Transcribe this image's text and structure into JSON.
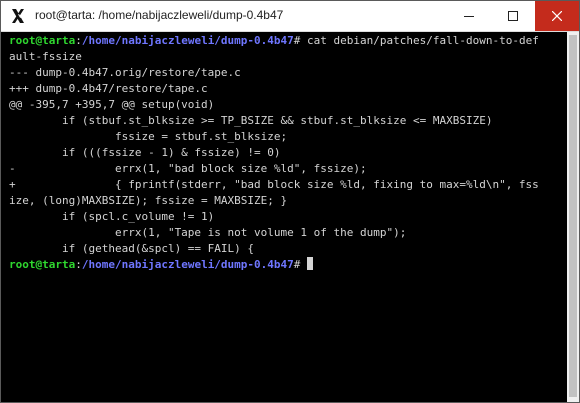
{
  "window": {
    "title": "root@tarta: /home/nabijaczleweli/dump-0.4b47",
    "app_icon": "x-window-icon",
    "controls": [
      "minimize-icon",
      "maximize-icon",
      "close-icon"
    ],
    "close_color": "#c42b1c"
  },
  "terminal": {
    "prompt": {
      "user_host": "root@tarta",
      "colon": ":",
      "path": "/home/nabijaczleweli/dump-0.4b47",
      "symbol": "#"
    },
    "command": " cat debian/patches/fall-down-to-def",
    "command_wrap": "ault-fssize",
    "output": [
      "--- dump-0.4b47.orig/restore/tape.c",
      "+++ dump-0.4b47/restore/tape.c",
      "@@ -395,7 +395,7 @@ setup(void)",
      "        if (stbuf.st_blksize >= TP_BSIZE && stbuf.st_blksize <= MAXBSIZE)",
      "                fssize = stbuf.st_blksize;",
      "        if (((fssize - 1) & fssize) != 0)",
      "-               errx(1, \"bad block size %ld\", fssize);",
      "+               { fprintf(stderr, \"bad block size %ld, fixing to max=%ld\\n\", fss",
      "ize, (long)MAXBSIZE); fssize = MAXBSIZE; }",
      "        if (spcl.c_volume != 1)",
      "                errx(1, \"Tape is not volume 1 of the dump\");",
      "        if (gethead(&spcl) == FAIL) {"
    ],
    "colors": {
      "background": "#000000",
      "text": "#d4d4d4",
      "prompt_user": "#2fd62f",
      "prompt_path": "#6f76ff"
    }
  }
}
